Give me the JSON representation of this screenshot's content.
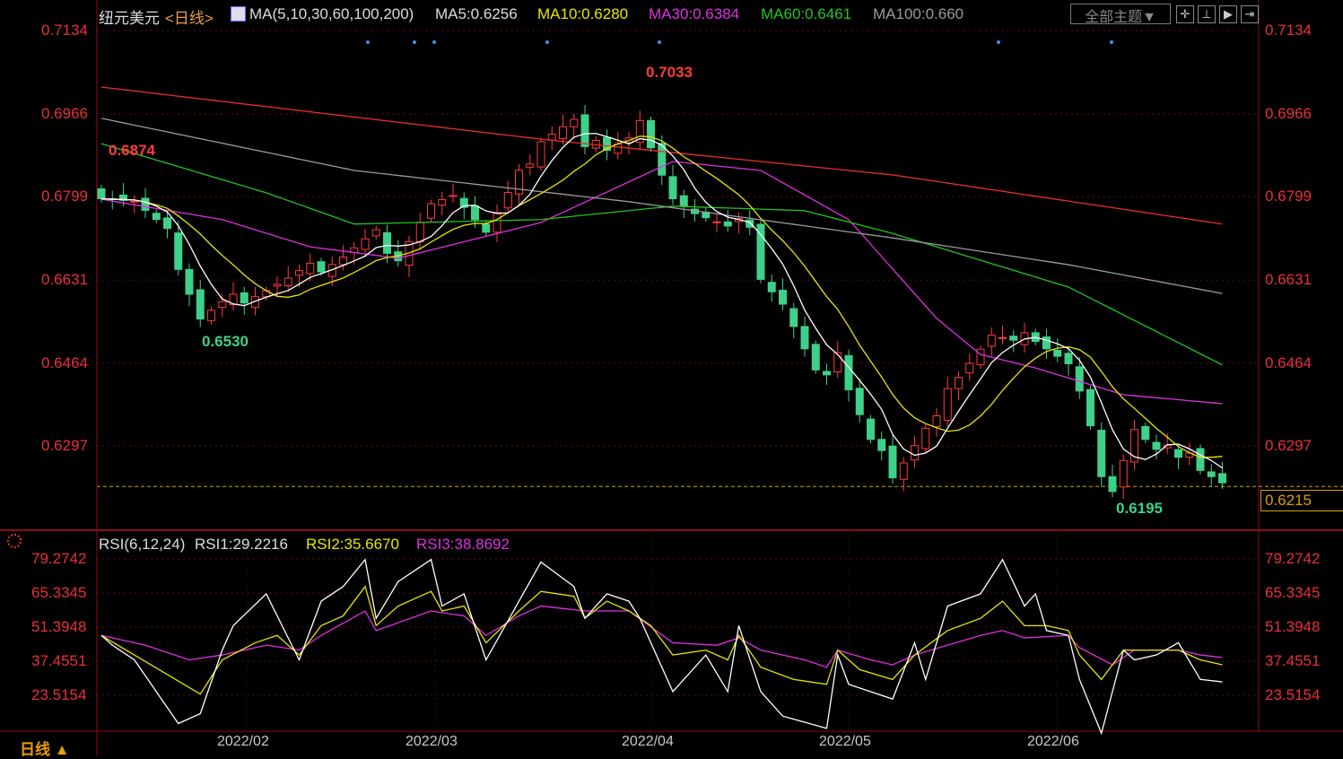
{
  "header": {
    "symbol": "纽元美元",
    "period": "<日线>",
    "ma_label": "MA(5,10,30,60,100,200)",
    "ma5": "MA5:0.6256",
    "ma10": "MA10:0.6280",
    "ma30": "MA30:0.6384",
    "ma60": "MA60:0.6461",
    "ma100": "MA100:0.660"
  },
  "toolbar": {
    "theme_button": "全部主题▼",
    "icons": [
      "crosshair-icon",
      "range-icon",
      "play-icon",
      "exit-icon"
    ]
  },
  "rsi_header": {
    "label": "RSI(6,12,24)",
    "rsi1": "RSI1:29.2216",
    "rsi2": "RSI2:35.6670",
    "rsi3": "RSI3:38.8692"
  },
  "footer": {
    "period": "日线 ▲"
  },
  "colors": {
    "up": "#ff3b3b",
    "down": "#3ed18a",
    "ma5": "#ffffff",
    "ma10": "#e6e600",
    "ma30": "#e030e0",
    "ma60": "#22c422",
    "ma100": "#9a9a9a",
    "ma200": "#e8302a"
  },
  "chart_data": {
    "type": "candlestick",
    "price_ticks": [
      "0.7134",
      "0.6966",
      "0.6799",
      "0.6631",
      "0.6464",
      "0.6297"
    ],
    "price_range": [
      0.605,
      0.7134
    ],
    "current_price": "0.6215",
    "annotations": {
      "high": "0.7033",
      "first_high": "0.6874",
      "low1": "0.6530",
      "low2": "0.6195"
    },
    "x_labels": [
      "2022/02",
      "2022/03",
      "2022/04",
      "2022/05",
      "2022/06"
    ],
    "close_path": [
      [
        0,
        0.681
      ],
      [
        3,
        0.679
      ],
      [
        6,
        0.672
      ],
      [
        9,
        0.6555
      ],
      [
        11,
        0.658
      ],
      [
        13,
        0.66
      ],
      [
        17,
        0.663
      ],
      [
        19,
        0.665
      ],
      [
        22,
        0.668
      ],
      [
        25,
        0.672
      ],
      [
        27,
        0.668
      ],
      [
        30,
        0.678
      ],
      [
        33,
        0.679
      ],
      [
        35,
        0.673
      ],
      [
        37,
        0.68
      ],
      [
        40,
        0.692
      ],
      [
        43,
        0.695
      ],
      [
        44,
        0.689
      ],
      [
        48,
        0.692
      ],
      [
        49,
        0.695
      ],
      [
        51,
        0.683
      ],
      [
        54,
        0.677
      ],
      [
        57,
        0.673
      ],
      [
        59,
        0.675
      ],
      [
        60,
        0.664
      ],
      [
        62,
        0.658
      ],
      [
        64,
        0.648
      ],
      [
        66,
        0.645
      ],
      [
        67,
        0.649
      ],
      [
        68,
        0.641
      ],
      [
        70,
        0.63
      ],
      [
        72,
        0.6245
      ],
      [
        73,
        0.627
      ],
      [
        75,
        0.633
      ],
      [
        76,
        0.635
      ],
      [
        78,
        0.645
      ],
      [
        81,
        0.652
      ],
      [
        83,
        0.65
      ],
      [
        85,
        0.652
      ],
      [
        88,
        0.646
      ],
      [
        89,
        0.64
      ],
      [
        91,
        0.625
      ],
      [
        92,
        0.6215
      ],
      [
        94,
        0.633
      ],
      [
        96,
        0.628
      ],
      [
        99,
        0.629
      ],
      [
        100,
        0.625
      ],
      [
        102,
        0.6215
      ]
    ],
    "ma_series": [
      {
        "name": "MA30",
        "points": [
          [
            0,
            0.6794
          ],
          [
            11,
            0.6753
          ],
          [
            19,
            0.6698
          ],
          [
            27,
            0.6675
          ],
          [
            40,
            0.6747
          ],
          [
            52,
            0.687
          ],
          [
            60,
            0.6852
          ],
          [
            68,
            0.6753
          ],
          [
            76,
            0.6554
          ],
          [
            80,
            0.6481
          ],
          [
            85,
            0.6454
          ],
          [
            93,
            0.64
          ],
          [
            102,
            0.6382
          ]
        ]
      },
      {
        "name": "MA60",
        "points": [
          [
            0,
            0.6906
          ],
          [
            15,
            0.6807
          ],
          [
            23,
            0.6744
          ],
          [
            40,
            0.6753
          ],
          [
            52,
            0.678
          ],
          [
            64,
            0.6771
          ],
          [
            72,
            0.6725
          ],
          [
            80,
            0.6671
          ],
          [
            88,
            0.6617
          ],
          [
            102,
            0.646
          ]
        ]
      },
      {
        "name": "MA100",
        "points": [
          [
            0,
            0.6957
          ],
          [
            23,
            0.6852
          ],
          [
            48,
            0.6789
          ],
          [
            72,
            0.6716
          ],
          [
            88,
            0.6662
          ],
          [
            102,
            0.6604
          ]
        ]
      },
      {
        "name": "MA200",
        "points": [
          [
            0,
            0.702
          ],
          [
            40,
            0.6915
          ],
          [
            72,
            0.6843
          ],
          [
            102,
            0.6744
          ]
        ]
      }
    ],
    "rsi": {
      "ticks": [
        "79.2742",
        "65.3345",
        "51.3948",
        "37.4551",
        "23.5154"
      ],
      "range": [
        23.5154,
        79.2742
      ],
      "series": [
        {
          "name": "RSI1",
          "points": [
            [
              0,
              48
            ],
            [
              1,
              44
            ],
            [
              3,
              38
            ],
            [
              5,
              25
            ],
            [
              7,
              12
            ],
            [
              9,
              16
            ],
            [
              11,
              42
            ],
            [
              12,
              52
            ],
            [
              15,
              65
            ],
            [
              18,
              38
            ],
            [
              20,
              62
            ],
            [
              22,
              68
            ],
            [
              24,
              79
            ],
            [
              25,
              55
            ],
            [
              27,
              70
            ],
            [
              30,
              79
            ],
            [
              31,
              60
            ],
            [
              33,
              65
            ],
            [
              35,
              38
            ],
            [
              38,
              62
            ],
            [
              40,
              78
            ],
            [
              43,
              68
            ],
            [
              44,
              55
            ],
            [
              46,
              65
            ],
            [
              48,
              62
            ],
            [
              49,
              55
            ],
            [
              52,
              25
            ],
            [
              53,
              30
            ],
            [
              55,
              40
            ],
            [
              57,
              25
            ],
            [
              58,
              52
            ],
            [
              60,
              25
            ],
            [
              62,
              15
            ],
            [
              66,
              10
            ],
            [
              67,
              40
            ],
            [
              68,
              28
            ],
            [
              70,
              25
            ],
            [
              72,
              22
            ],
            [
              74,
              45
            ],
            [
              75,
              30
            ],
            [
              77,
              60
            ],
            [
              80,
              65
            ],
            [
              82,
              79
            ],
            [
              84,
              60
            ],
            [
              85,
              65
            ],
            [
              86,
              50
            ],
            [
              88,
              48
            ],
            [
              89,
              30
            ],
            [
              91,
              8
            ],
            [
              93,
              42
            ],
            [
              94,
              38
            ],
            [
              96,
              40
            ],
            [
              98,
              45
            ],
            [
              100,
              30
            ],
            [
              102,
              29
            ]
          ]
        },
        {
          "name": "RSI2",
          "points": [
            [
              0,
              48
            ],
            [
              3,
              40
            ],
            [
              6,
              32
            ],
            [
              9,
              24
            ],
            [
              11,
              38
            ],
            [
              14,
              45
            ],
            [
              16,
              48
            ],
            [
              18,
              40
            ],
            [
              20,
              52
            ],
            [
              22,
              56
            ],
            [
              24,
              68
            ],
            [
              25,
              52
            ],
            [
              27,
              60
            ],
            [
              30,
              66
            ],
            [
              31,
              58
            ],
            [
              33,
              60
            ],
            [
              35,
              45
            ],
            [
              38,
              58
            ],
            [
              40,
              66
            ],
            [
              43,
              64
            ],
            [
              44,
              55
            ],
            [
              46,
              62
            ],
            [
              48,
              58
            ],
            [
              50,
              52
            ],
            [
              52,
              40
            ],
            [
              55,
              42
            ],
            [
              57,
              38
            ],
            [
              58,
              48
            ],
            [
              60,
              35
            ],
            [
              63,
              30
            ],
            [
              66,
              28
            ],
            [
              67,
              42
            ],
            [
              69,
              34
            ],
            [
              72,
              30
            ],
            [
              74,
              40
            ],
            [
              77,
              50
            ],
            [
              80,
              55
            ],
            [
              82,
              62
            ],
            [
              84,
              52
            ],
            [
              86,
              52
            ],
            [
              88,
              50
            ],
            [
              89,
              40
            ],
            [
              91,
              30
            ],
            [
              93,
              42
            ],
            [
              96,
              42
            ],
            [
              98,
              42
            ],
            [
              100,
              38
            ],
            [
              102,
              36
            ]
          ]
        },
        {
          "name": "RSI3",
          "points": [
            [
              0,
              48
            ],
            [
              4,
              44
            ],
            [
              8,
              38
            ],
            [
              11,
              40
            ],
            [
              15,
              44
            ],
            [
              18,
              42
            ],
            [
              20,
              48
            ],
            [
              24,
              58
            ],
            [
              25,
              50
            ],
            [
              30,
              58
            ],
            [
              33,
              56
            ],
            [
              35,
              48
            ],
            [
              38,
              56
            ],
            [
              40,
              60
            ],
            [
              44,
              58
            ],
            [
              48,
              58
            ],
            [
              52,
              45
            ],
            [
              56,
              44
            ],
            [
              58,
              47
            ],
            [
              60,
              42
            ],
            [
              64,
              38
            ],
            [
              66,
              35
            ],
            [
              67,
              42
            ],
            [
              70,
              38
            ],
            [
              72,
              36
            ],
            [
              74,
              40
            ],
            [
              77,
              44
            ],
            [
              80,
              48
            ],
            [
              82,
              50
            ],
            [
              84,
              47
            ],
            [
              88,
              48
            ],
            [
              89,
              43
            ],
            [
              92,
              36
            ],
            [
              94,
              42
            ],
            [
              98,
              42
            ],
            [
              100,
              40
            ],
            [
              102,
              39
            ]
          ]
        }
      ]
    }
  }
}
